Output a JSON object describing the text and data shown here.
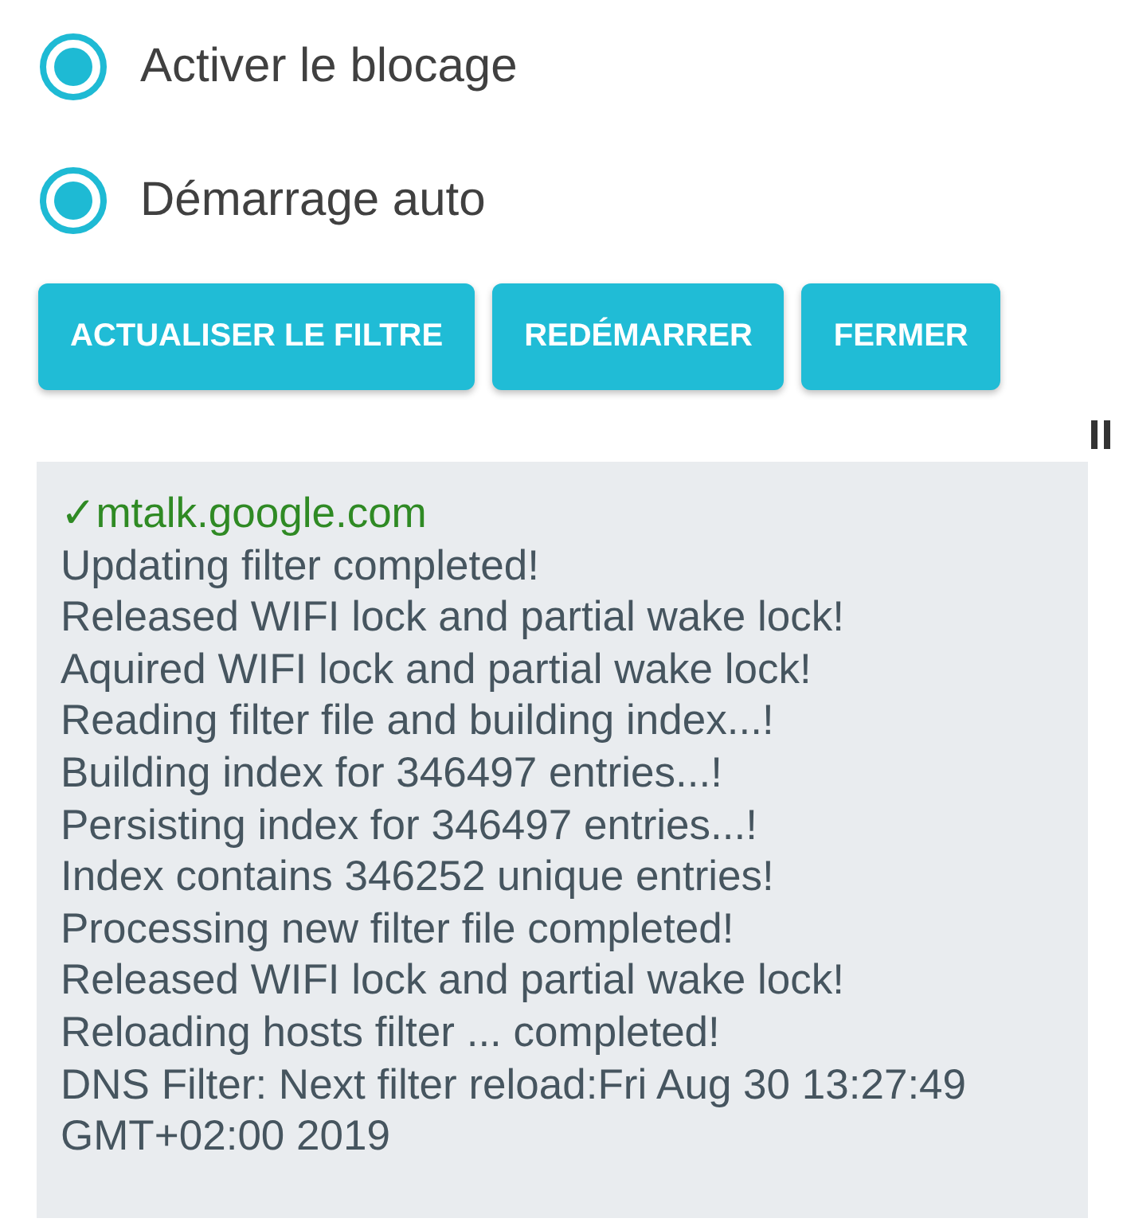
{
  "options": [
    {
      "label": "Activer le blocage",
      "checked": true
    },
    {
      "label": "Démarrage auto",
      "checked": true
    }
  ],
  "buttons": [
    "ACTUALISER LE FILTRE",
    "REDÉMARRER",
    "FERMER"
  ],
  "log": {
    "lines": [
      {
        "kind": "allowed",
        "text": "✓mtalk.google.com"
      },
      {
        "kind": "info",
        "text": "Updating filter completed!"
      },
      {
        "kind": "info",
        "text": "Released WIFI lock and partial wake lock!"
      },
      {
        "kind": "info",
        "text": "Aquired WIFI lock and partial wake lock!"
      },
      {
        "kind": "info",
        "text": "Reading filter file and building index...!"
      },
      {
        "kind": "info",
        "text": "Building index for 346497 entries...!"
      },
      {
        "kind": "info",
        "text": "Persisting index for 346497 entries...!"
      },
      {
        "kind": "info",
        "text": "Index contains 346252 unique entries!"
      },
      {
        "kind": "info",
        "text": "Processing new filter file completed!"
      },
      {
        "kind": "info",
        "text": "Released WIFI lock and partial wake lock!"
      },
      {
        "kind": "info",
        "text": "Reloading hosts filter ... completed!"
      },
      {
        "kind": "info",
        "text": "DNS Filter: Next filter reload:Fri Aug 30 13:27:49 GMT+02:00 2019"
      }
    ]
  }
}
